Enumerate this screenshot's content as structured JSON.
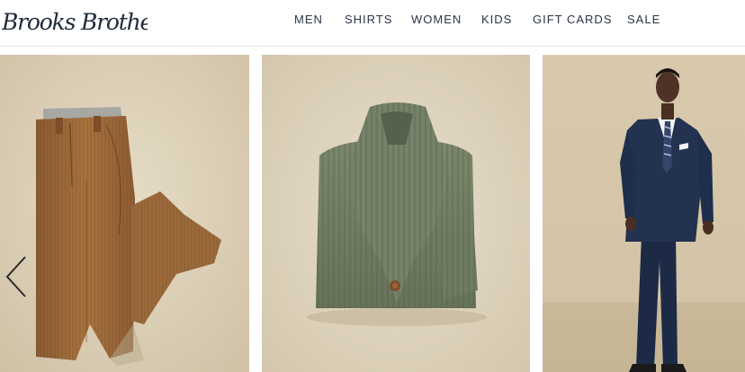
{
  "brand": {
    "name": "Brooks Brothers"
  },
  "nav": {
    "items": [
      {
        "label": "MEN"
      },
      {
        "label": "SHIRTS"
      },
      {
        "label": "WOMEN"
      },
      {
        "label": "KIDS"
      },
      {
        "label": "GIFT CARDS"
      },
      {
        "label": "SALE"
      }
    ]
  },
  "carousel": {
    "slides": [
      {
        "product": "corduroy-pants"
      },
      {
        "product": "shawl-collar-cardigan"
      },
      {
        "product": "navy-suit"
      }
    ],
    "prev_icon": "chevron-left-icon"
  },
  "colors": {
    "brand_navy": "#1f2a3a",
    "nav_text": "#2b3446",
    "backdrop": "#d9ccb3",
    "pants": "#9a6a3e",
    "cardigan": "#6f7c62",
    "suit": "#1f2d4a"
  }
}
